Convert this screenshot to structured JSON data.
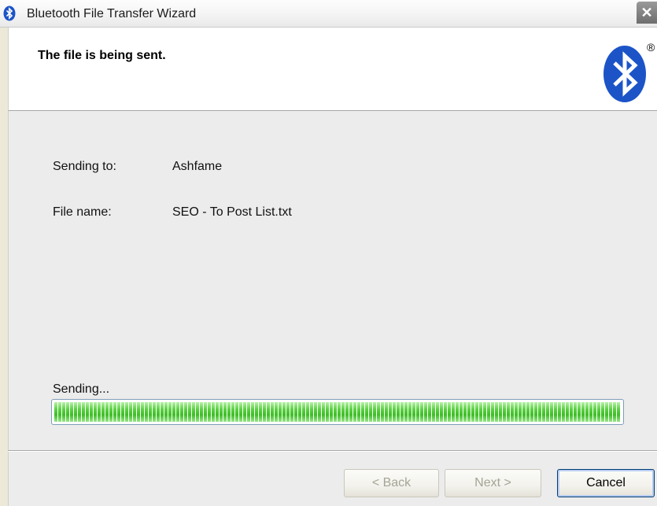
{
  "window": {
    "title": "Bluetooth File Transfer Wizard",
    "close_symbol": "✕"
  },
  "header": {
    "title": "The file is being sent.",
    "logo_mark": "®"
  },
  "details": {
    "sending_to_label": "Sending to:",
    "sending_to_value": "Ashfame",
    "file_name_label": "File name:",
    "file_name_value": "SEO - To Post List.txt"
  },
  "progress": {
    "label": "Sending...",
    "percent": 100
  },
  "buttons": {
    "back": "< Back",
    "next": "Next >",
    "cancel": "Cancel"
  },
  "colors": {
    "bluetooth_blue": "#1c54c8",
    "progress_green": "#3ebd27"
  }
}
